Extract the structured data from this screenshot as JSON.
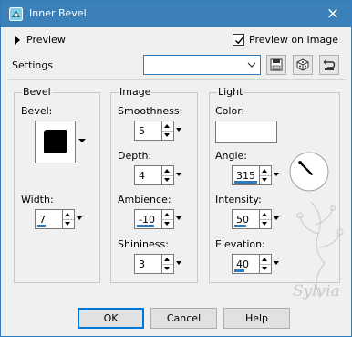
{
  "window": {
    "title": "Inner Bevel",
    "close_glyph": "×"
  },
  "preview": {
    "label": "Preview",
    "preview_on_image_label": "Preview on Image",
    "preview_on_image_checked": true
  },
  "settings": {
    "label": "Settings",
    "preset_value": "",
    "tool_icons": [
      "save-preset-icon",
      "randomize-icon",
      "reset-icon"
    ]
  },
  "bevel_group": {
    "title": "Bevel",
    "bevel_label": "Bevel:",
    "width_label": "Width:",
    "width_value": "7"
  },
  "image_group": {
    "title": "Image",
    "smoothness_label": "Smoothness:",
    "smoothness_value": "5",
    "depth_label": "Depth:",
    "depth_value": "4",
    "ambience_label": "Ambience:",
    "ambience_value": "-10",
    "shininess_label": "Shininess:",
    "shininess_value": "3"
  },
  "light_group": {
    "title": "Light",
    "color_label": "Color:",
    "color_value": "#ffffff",
    "angle_label": "Angle:",
    "angle_value": "315",
    "intensity_label": "Intensity:",
    "intensity_value": "50",
    "elevation_label": "Elevation:",
    "elevation_value": "40"
  },
  "buttons": {
    "ok": "OK",
    "cancel": "Cancel",
    "help": "Help"
  },
  "watermark": {
    "text": "Sylvia"
  },
  "colors": {
    "titlebar": "#3b80b8",
    "accent": "#2a7cc2"
  }
}
